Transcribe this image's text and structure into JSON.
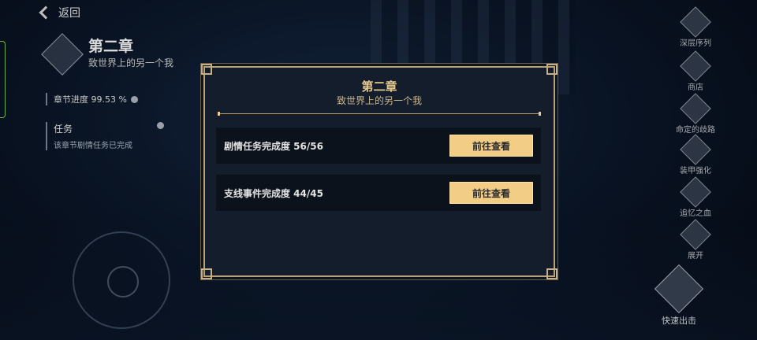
{
  "header": {
    "back_label": "返回"
  },
  "chapter": {
    "title": "第二章",
    "subtitle": "致世界上的另一个我",
    "progress_label": "章节进度 99.53 %",
    "tasks_label": "任务",
    "tasks_status": "该章节剧情任务已完成"
  },
  "sidebar": {
    "items": [
      {
        "label": "深层序列",
        "icon": "deep-sequence-icon"
      },
      {
        "label": "商店",
        "icon": "shop-icon"
      },
      {
        "label": "命定的歧路",
        "icon": "fate-path-icon"
      },
      {
        "label": "装甲强化",
        "icon": "armor-upgrade-icon"
      },
      {
        "label": "追忆之血",
        "icon": "memory-blood-icon"
      },
      {
        "label": "展开",
        "icon": "expand-icon"
      }
    ],
    "dash_label": "快速出击"
  },
  "modal": {
    "title": "第二章",
    "subtitle": "致世界上的另一个我",
    "rows": [
      {
        "label": "剧情任务完成度 56/56",
        "button": "前往查看"
      },
      {
        "label": "支线事件完成度 44/45",
        "button": "前往查看"
      }
    ]
  },
  "colors": {
    "accent_gold": "#f2cd86",
    "modal_bg": "#141d2c",
    "title_gold": "#e8c98d"
  }
}
